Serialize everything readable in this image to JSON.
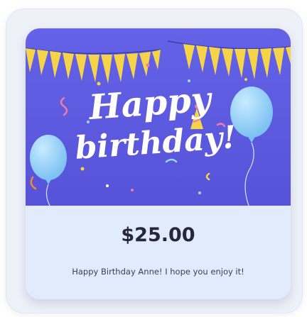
{
  "card": {
    "image": {
      "headline_line1": "Happy",
      "headline_line2": "birthday!",
      "background_color": "#5f5ce2",
      "banner_color": "#f6d44a",
      "balloon_color": "#8fd0f7"
    },
    "amount": "$25.00",
    "message": "Happy Birthday Anne! I hope you enjoy it!"
  }
}
